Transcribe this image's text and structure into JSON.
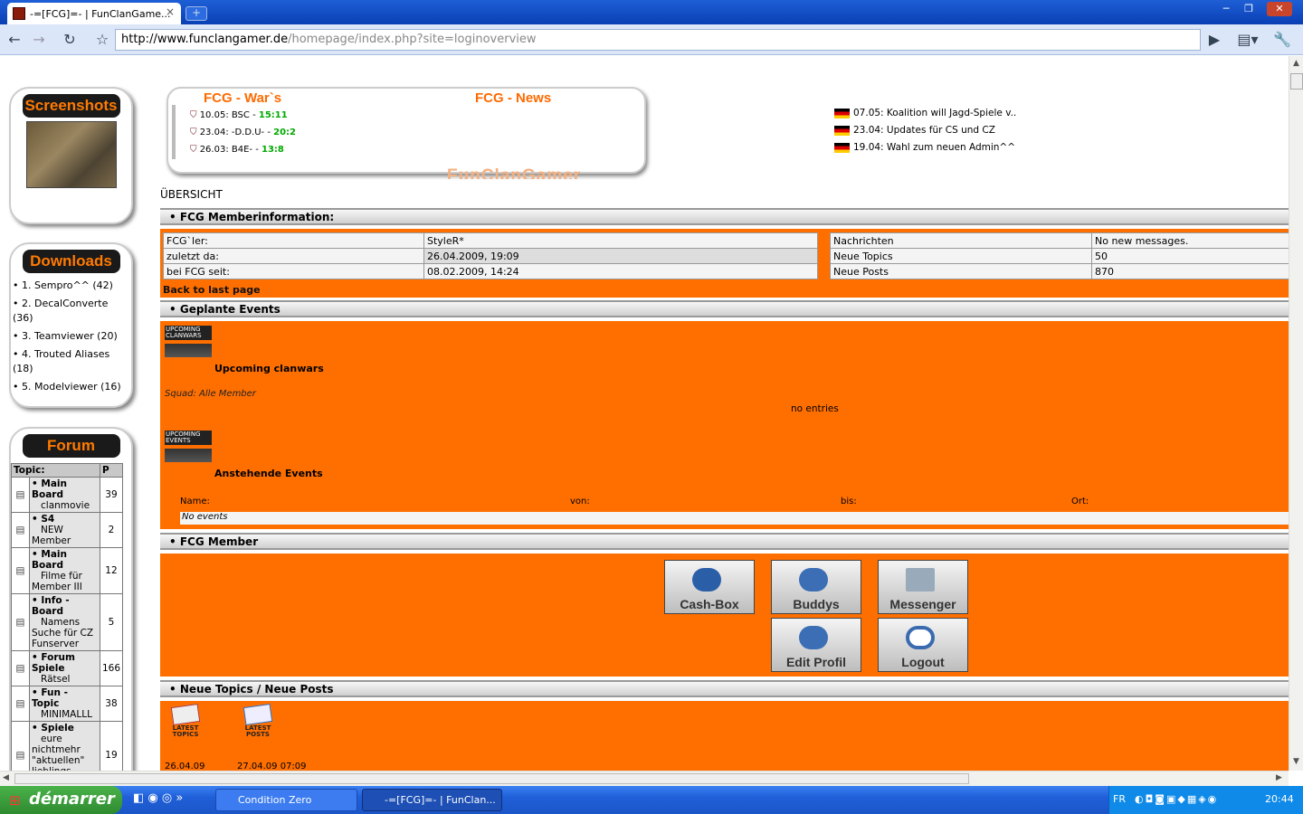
{
  "browser": {
    "tab_title": "-=[FCG]=- | FunClanGame...",
    "tab_close": "×",
    "new_tab": "+",
    "url_host": "http://www.funclangamer.de",
    "url_path": "/homepage/index.php?site=loginoverview",
    "min": "─",
    "max": "❐",
    "close": "✕"
  },
  "sidebar": {
    "screenshots_title": "Screenshots",
    "downloads_title": "Downloads",
    "downloads": [
      "1. Sempro^^ (42)",
      "2. DecalConverte (36)",
      "3. Teamviewer (20)",
      "4. Trouted Aliases (18)",
      "5. Modelviewer (16)"
    ],
    "forum_title": "Forum",
    "forum_col_topic": "Topic:",
    "forum_col_p": "P",
    "forum": [
      {
        "board": "Main Board",
        "title": "clanmovie",
        "posts": "39"
      },
      {
        "board": "S4",
        "title": "NEW Member",
        "posts": "2"
      },
      {
        "board": "Main Board",
        "title": "Filme für Member III",
        "posts": "12"
      },
      {
        "board": "Info - Board",
        "title": "Namens Suche für CZ Funserver",
        "posts": "5"
      },
      {
        "board": "Forum Spiele",
        "title": "Rätsel",
        "posts": "166"
      },
      {
        "board": "Fun - Topic",
        "title": "MINIMALLL",
        "posts": "38"
      },
      {
        "board": "Spiele",
        "title": "eure nichtmehr \"aktuellen\" lieblings games",
        "posts": "19"
      }
    ]
  },
  "header": {
    "wars_title": "FCG - War`s",
    "news_title": "FCG - News",
    "wars": [
      {
        "date": "10.05:",
        "opp": "BSC",
        "score": "15:11"
      },
      {
        "date": "23.04:",
        "opp": "-D.D.U-",
        "score": "20:2"
      },
      {
        "date": "26.03:",
        "opp": "B4E-",
        "score": "13:8"
      }
    ],
    "news": [
      "07.05: Koalition will Jagd-Spiele v..",
      "23.04: Updates für CS und CZ",
      "19.04: Wahl zum neuen Admin^^"
    ],
    "watermark": "FunClanGamer"
  },
  "main": {
    "title": "ÜBERSICHT",
    "member_info_title": "• FCG Memberinformation:",
    "left_rows": [
      {
        "label": "FCG`ler:",
        "value": "StyleR*"
      },
      {
        "label": "zuletzt da:",
        "value": "26.04.2009, 19:09"
      },
      {
        "label": "bei FCG seit:",
        "value": "08.02.2009, 14:24"
      }
    ],
    "right_rows": [
      {
        "label": "Nachrichten",
        "value": "No new messages."
      },
      {
        "label": "Neue Topics",
        "value": "50"
      },
      {
        "label": "Neue Posts",
        "value": "870"
      }
    ],
    "back_link": "Back to last page",
    "events_title": "• Geplante Events",
    "upcoming_badge": "UPCOMING CLANWARS",
    "upcoming_clanwars": "Upcoming clanwars",
    "squad": "Squad: Alle Member",
    "no_entries": "no entries",
    "events_badge": "UPCOMING EVENTS",
    "anstehende": "Anstehende Events",
    "ev_cols": [
      "Name:",
      "von:",
      "bis:",
      "Ort:"
    ],
    "no_events": "No events",
    "member_title": "• FCG Member",
    "buttons": [
      "Cash-Box",
      "Buddys",
      "Messenger",
      "Edit Profil",
      "Logout"
    ],
    "topics_title": "• Neue Topics / Neue Posts",
    "latest_topics": "LATEST TOPICS",
    "latest_posts": "LATEST POSTS",
    "date1": "26.04.09",
    "date2": "27.04.09 07:09"
  },
  "taskbar": {
    "start": "démarrer",
    "task1": "Condition Zero",
    "task2": "-=[FCG]=- | FunClan...",
    "lang": "FR",
    "clock": "20:44"
  }
}
